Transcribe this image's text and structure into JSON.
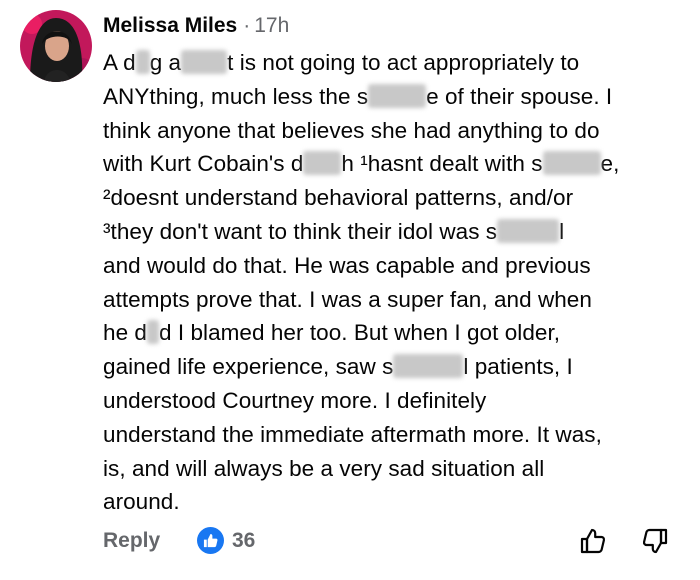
{
  "comment": {
    "author": "Melissa Miles",
    "separator": "·",
    "time": "17h",
    "text_segments": {
      "l1a": "A d",
      "l1b": "g a",
      "l1c": "t is not going to act appropriately to",
      "l2a": "ANYthing, much less the s",
      "l2b": "e of their spouse. I",
      "l3a": "think anyone that believes she had anything to do",
      "l4a": "with Kurt Cobain's d",
      "l4b": "h ¹hasnt dealt with s",
      "l4c": "e,",
      "l5a": "²doesnt understand behavioral patterns, and/or",
      "l6a": "³they don't want to think their idol was s",
      "l6b": "l",
      "l7a": "and would do that. He was capable and previous",
      "l8a": "attempts prove that. I was a super fan, and when",
      "l9a": "he d",
      "l9b": "d I blamed her too. But when I got older,",
      "l10a": "gained life experience, saw s",
      "l10b": "l patients, I",
      "l11a": "understood Courtney more. I definitely",
      "l12a": "understand the immediate aftermath more. It was,",
      "l13a": "is, and will always be a very sad situation all",
      "l14a": "around."
    }
  },
  "actions": {
    "reply_label": "Reply",
    "like_count": "36",
    "like_icon": "thumbs-up-icon",
    "upvote_icon": "thumb-up-outline-icon",
    "downvote_icon": "thumb-down-outline-icon"
  },
  "colors": {
    "text": "#050505",
    "secondary": "#65676b",
    "like_blue": "#1877f2",
    "redaction": "#c8c8c8"
  }
}
